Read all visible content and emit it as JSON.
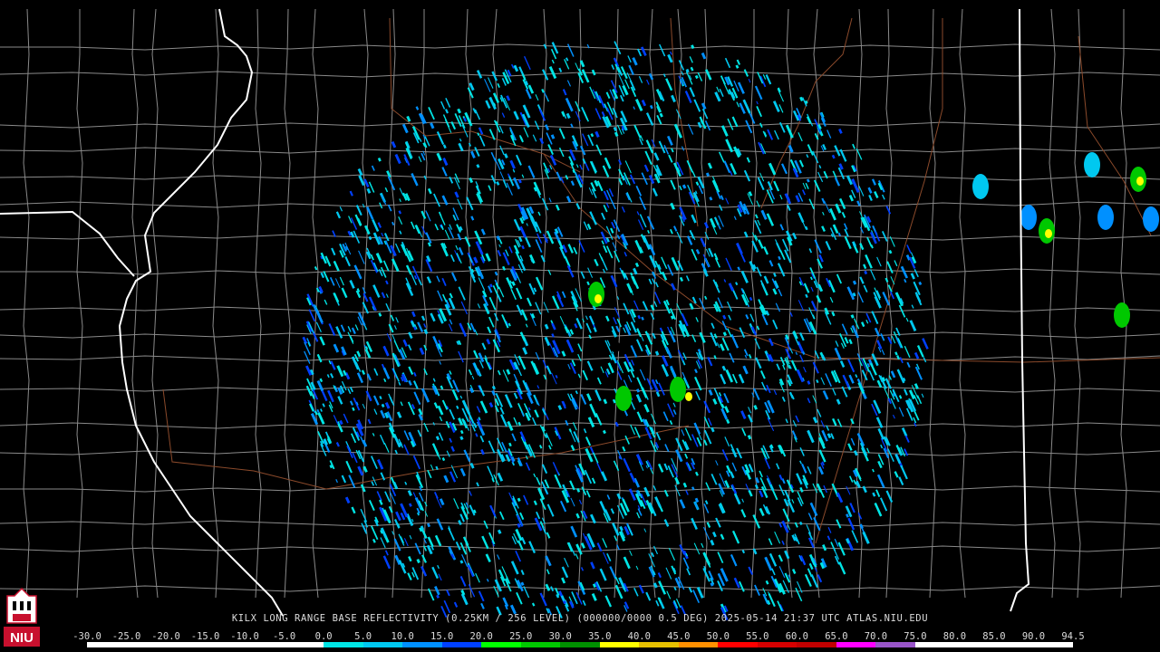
{
  "caption": "KILX LONG RANGE BASE REFLECTIVITY (0.25KM / 256 LEVEL) (000000/0000 0.5 DEG) 2025-05-14 21:37 UTC  ATLAS.NIU.EDU",
  "logo": {
    "text": "NIU",
    "icon": "niu-tower-icon"
  },
  "colorbar": {
    "ticks": [
      "-30.0",
      "-25.0",
      "-20.0",
      "-15.0",
      "-10.0",
      "-5.0",
      "0.0",
      "5.0",
      "10.0",
      "15.0",
      "20.0",
      "25.0",
      "30.0",
      "35.0",
      "40.0",
      "45.0",
      "50.0",
      "55.0",
      "60.0",
      "65.0",
      "70.0",
      "75.0",
      "80.0",
      "85.0",
      "90.0",
      "94.5"
    ],
    "colors": [
      "#ffffff",
      "#ffffff",
      "#ffffff",
      "#ffffff",
      "#ffffff",
      "#ffffff",
      "#00e5e5",
      "#00c8f0",
      "#0090ff",
      "#0040ff",
      "#00ff00",
      "#00c800",
      "#009000",
      "#ffff00",
      "#e6c000",
      "#ff9000",
      "#ff0000",
      "#d60000",
      "#c00000",
      "#ff00ff",
      "#9955c9",
      "#ffffff",
      "#ffffff",
      "#ffffff",
      "#ffffff"
    ]
  },
  "colors": {
    "background": "#000000",
    "county_lines": "#8a8a8a",
    "state_lines": "#ffffff",
    "highways": "#8b4a2b"
  }
}
